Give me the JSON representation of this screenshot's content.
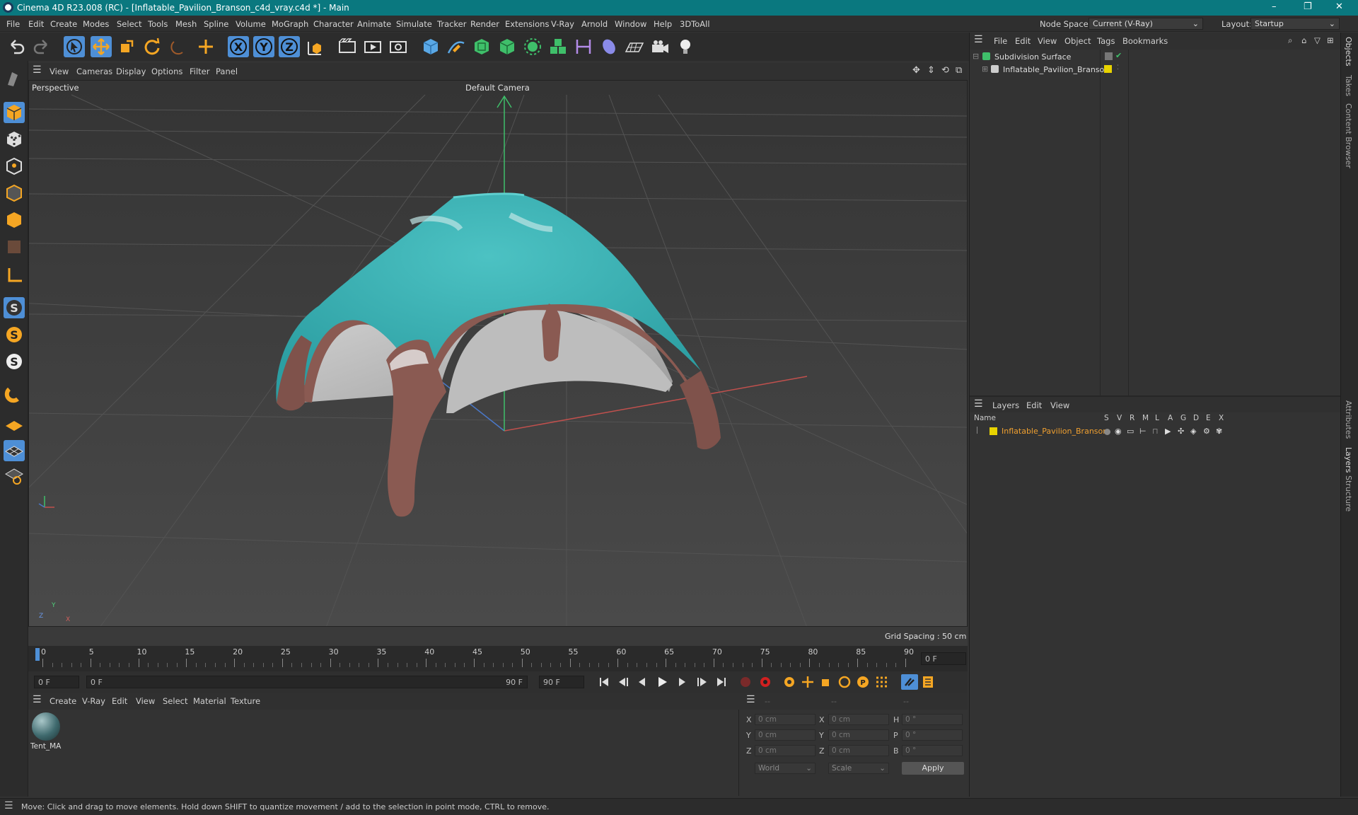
{
  "window": {
    "title": "Cinema 4D R23.008 (RC) - [Inflatable_Pavilion_Branson_c4d_vray.c4d *] - Main"
  },
  "menu": {
    "items": [
      "File",
      "Edit",
      "Create",
      "Modes",
      "Select",
      "Tools",
      "Mesh",
      "Spline",
      "Volume",
      "MoGraph",
      "Character",
      "Animate",
      "Simulate",
      "Tracker",
      "Render",
      "Extensions",
      "V-Ray",
      "Arnold",
      "Window",
      "Help",
      "3DToAll"
    ],
    "node_space_label": "Node Space:",
    "node_space_value": "Current (V-Ray)",
    "layout_label": "Layout:",
    "layout_value": "Startup"
  },
  "viewport": {
    "menu": [
      "View",
      "Cameras",
      "Display",
      "Options",
      "Filter",
      "Panel"
    ],
    "name": "Perspective",
    "camera": "Default Camera",
    "grid_spacing": "Grid Spacing : 50 cm",
    "axis": {
      "x": "X",
      "y": "Y",
      "z": "Z"
    }
  },
  "timeline": {
    "ticks": [
      "0",
      "5",
      "10",
      "15",
      "20",
      "25",
      "30",
      "35",
      "40",
      "45",
      "50",
      "55",
      "60",
      "65",
      "70",
      "75",
      "80",
      "85",
      "90"
    ],
    "end_field": "0 F"
  },
  "playback": {
    "start": "0 F",
    "current": "0 F",
    "range_end": "90 F",
    "end": "90 F"
  },
  "materials": {
    "menu": [
      "Create",
      "V-Ray",
      "Edit",
      "View",
      "Select",
      "Material",
      "Texture"
    ],
    "items": [
      {
        "name": "Tent_MA"
      }
    ]
  },
  "coords": {
    "header": [
      "--",
      "--",
      "--"
    ],
    "rows": [
      {
        "a": "X",
        "av": "0 cm",
        "b": "X",
        "bv": "0 cm",
        "c": "H",
        "cv": "0 °"
      },
      {
        "a": "Y",
        "av": "0 cm",
        "b": "Y",
        "bv": "0 cm",
        "c": "P",
        "cv": "0 °"
      },
      {
        "a": "Z",
        "av": "0 cm",
        "b": "Z",
        "bv": "0 cm",
        "c": "B",
        "cv": "0 °"
      }
    ],
    "mode": "World",
    "size": "Scale",
    "apply": "Apply"
  },
  "objects": {
    "menu": [
      "File",
      "Edit",
      "View",
      "Object",
      "Tags",
      "Bookmarks"
    ],
    "items": [
      {
        "name": "Subdivision Surface"
      },
      {
        "name": "Inflatable_Pavilion_Branson"
      }
    ]
  },
  "layers": {
    "menu": [
      "Layers",
      "Edit",
      "View"
    ],
    "columns": [
      "Name",
      "S",
      "V",
      "R",
      "M",
      "L",
      "A",
      "G",
      "D",
      "E",
      "X"
    ],
    "items": [
      {
        "name": "Inflatable_Pavilion_Branson",
        "color": "#e8d300"
      }
    ]
  },
  "side_tabs": [
    "Objects",
    "Takes",
    "Content Browser",
    "Attributes",
    "Layers",
    "Structure"
  ],
  "status": "Move: Click and drag to move elements. Hold down SHIFT to quantize movement / add to the selection in point mode, CTRL to remove.",
  "colors": {
    "titlebar": "#0a787f",
    "accent": "#4e8fd6",
    "canopy": "#3fb4b6",
    "frame": "#8a5a52",
    "layer_name": "#f0a030"
  }
}
